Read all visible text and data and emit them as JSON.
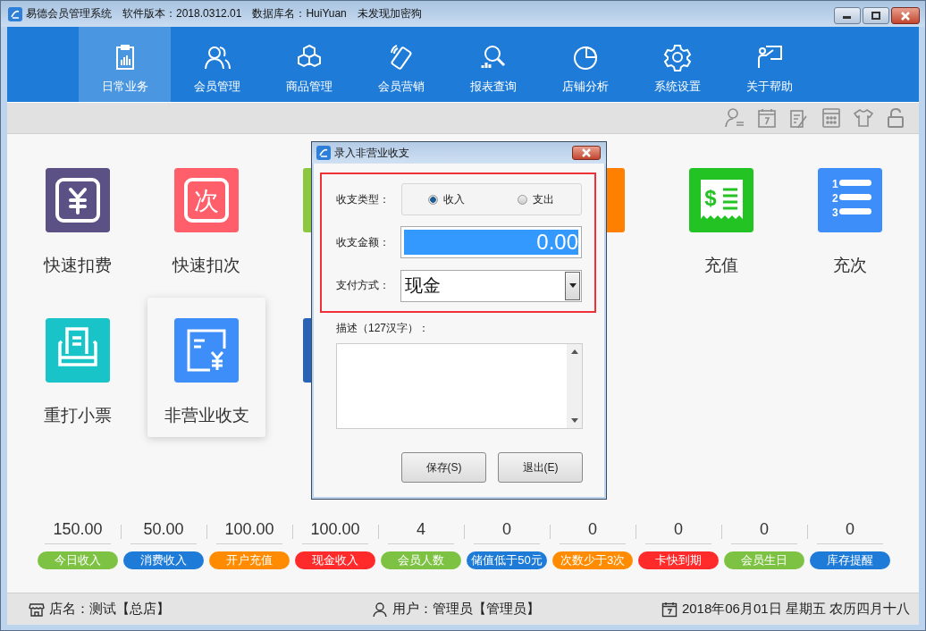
{
  "window": {
    "title": "易德会员管理系统",
    "version": "软件版本：2018.0312.01",
    "database": "数据库名：HuiYuan",
    "dongle": "未发现加密狗"
  },
  "nav": [
    {
      "label": "日常业务",
      "selected": true
    },
    {
      "label": "会员管理",
      "selected": false
    },
    {
      "label": "商品管理",
      "selected": false
    },
    {
      "label": "会员营销",
      "selected": false
    },
    {
      "label": "报表查询",
      "selected": false
    },
    {
      "label": "店铺分析",
      "selected": false
    },
    {
      "label": "系统设置",
      "selected": false
    },
    {
      "label": "关于帮助",
      "selected": false
    }
  ],
  "tiles": [
    {
      "kind": "yen",
      "label": "快速扣费",
      "color": "#5b5184",
      "selected": false
    },
    {
      "kind": "glyph",
      "label": "快速扣次",
      "glyph": "次",
      "color": "#ff5f6b",
      "selected": false
    },
    {
      "kind": "partial",
      "color": "#8dc63f",
      "selected": false
    },
    {
      "kind": "covered"
    },
    {
      "kind": "partial",
      "color": "#ff8000",
      "selected": false
    },
    {
      "kind": "receipt",
      "label": "充值",
      "glyph": "$",
      "color": "#22c322",
      "selected": false
    },
    {
      "kind": "list",
      "label": "充次",
      "marks": [
        "1",
        "2",
        "3"
      ],
      "color": "#3d8ef8",
      "selected": false
    },
    {
      "kind": "printer",
      "label": "重打小票",
      "color": "#19c4c9",
      "selected": false
    },
    {
      "kind": "bill",
      "label": "非营业收支",
      "color": "#3d8ef8",
      "selected": true
    },
    {
      "kind": "partial",
      "color": "#2a62b6",
      "selected": false
    }
  ],
  "stats": [
    {
      "value": "150.00",
      "label": "今日收入",
      "color": "#7dc242"
    },
    {
      "value": "50.00",
      "label": "消费收入",
      "color": "#1e7bd7"
    },
    {
      "value": "100.00",
      "label": "开户充值",
      "color": "#ff8c00"
    },
    {
      "value": "100.00",
      "label": "现金收入",
      "color": "#ff2a2a"
    },
    {
      "value": "4",
      "label": "会员人数",
      "color": "#7dc242"
    },
    {
      "value": "0",
      "label": "储值低于50元",
      "color": "#1e7bd7"
    },
    {
      "value": "0",
      "label": "次数少于3次",
      "color": "#ff8c00"
    },
    {
      "value": "0",
      "label": "卡快到期",
      "color": "#ff2a2a"
    },
    {
      "value": "0",
      "label": "会员生日",
      "color": "#7dc242"
    },
    {
      "value": "0",
      "label": "库存提醒",
      "color": "#1e7bd7"
    }
  ],
  "status_bar": {
    "shop": "店名：测试【总店】",
    "user": "用户：管理员【管理员】",
    "date": "2018年06月01日 星期五 农历四月十八"
  },
  "dialog": {
    "title": "录入非营业收支",
    "fields": [
      {
        "kind": "radio",
        "label": "收支类型：",
        "options": [
          {
            "label": "收入",
            "selected": true
          },
          {
            "label": "支出",
            "selected": false
          }
        ]
      },
      {
        "kind": "amount",
        "label": "收支金额：",
        "value": "0.00"
      },
      {
        "kind": "select",
        "label": "支付方式：",
        "value": "现金"
      }
    ],
    "description_label": "描述（127汉字）：",
    "buttons": [
      "保存(S)",
      "退出(E)"
    ]
  }
}
